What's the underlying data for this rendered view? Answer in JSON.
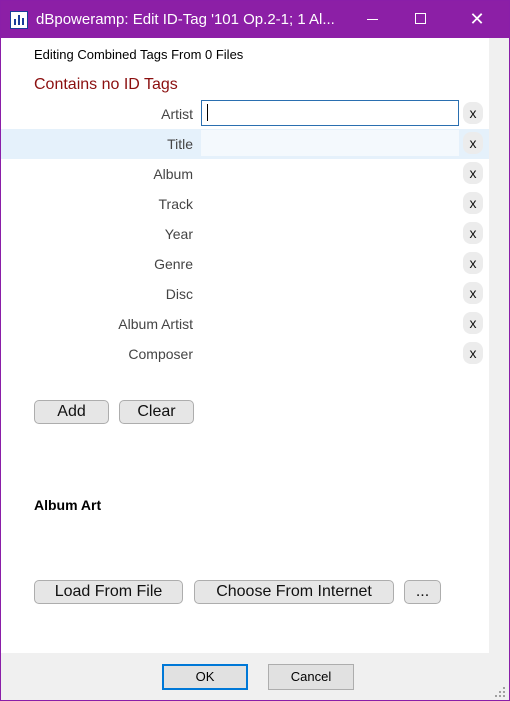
{
  "window": {
    "title": "dBpoweramp: Edit ID-Tag '101 Op.2-1; 1 Al...",
    "accent_color": "#8c1fa6",
    "minimize_icon": "minimize-icon",
    "maximize_icon": "maximize-icon",
    "close_glyph": "✕"
  },
  "header": {
    "editing_text": "Editing Combined Tags From 0 Files",
    "warning_text": "Contains no ID Tags",
    "warning_color": "#8b0f0f"
  },
  "tags": {
    "clear_glyph": "x",
    "fields": [
      {
        "label": "Artist",
        "value": ""
      },
      {
        "label": "Title",
        "value": ""
      },
      {
        "label": "Album",
        "value": ""
      },
      {
        "label": "Track",
        "value": ""
      },
      {
        "label": "Year",
        "value": ""
      },
      {
        "label": "Genre",
        "value": ""
      },
      {
        "label": "Disc",
        "value": ""
      },
      {
        "label": "Album Artist",
        "value": ""
      },
      {
        "label": "Composer",
        "value": ""
      }
    ],
    "add_label": "Add",
    "clear_label": "Clear"
  },
  "album_art": {
    "heading": "Album Art",
    "load_label": "Load From File",
    "choose_label": "Choose From Internet",
    "more_label": "..."
  },
  "dialog": {
    "ok_label": "OK",
    "cancel_label": "Cancel"
  }
}
